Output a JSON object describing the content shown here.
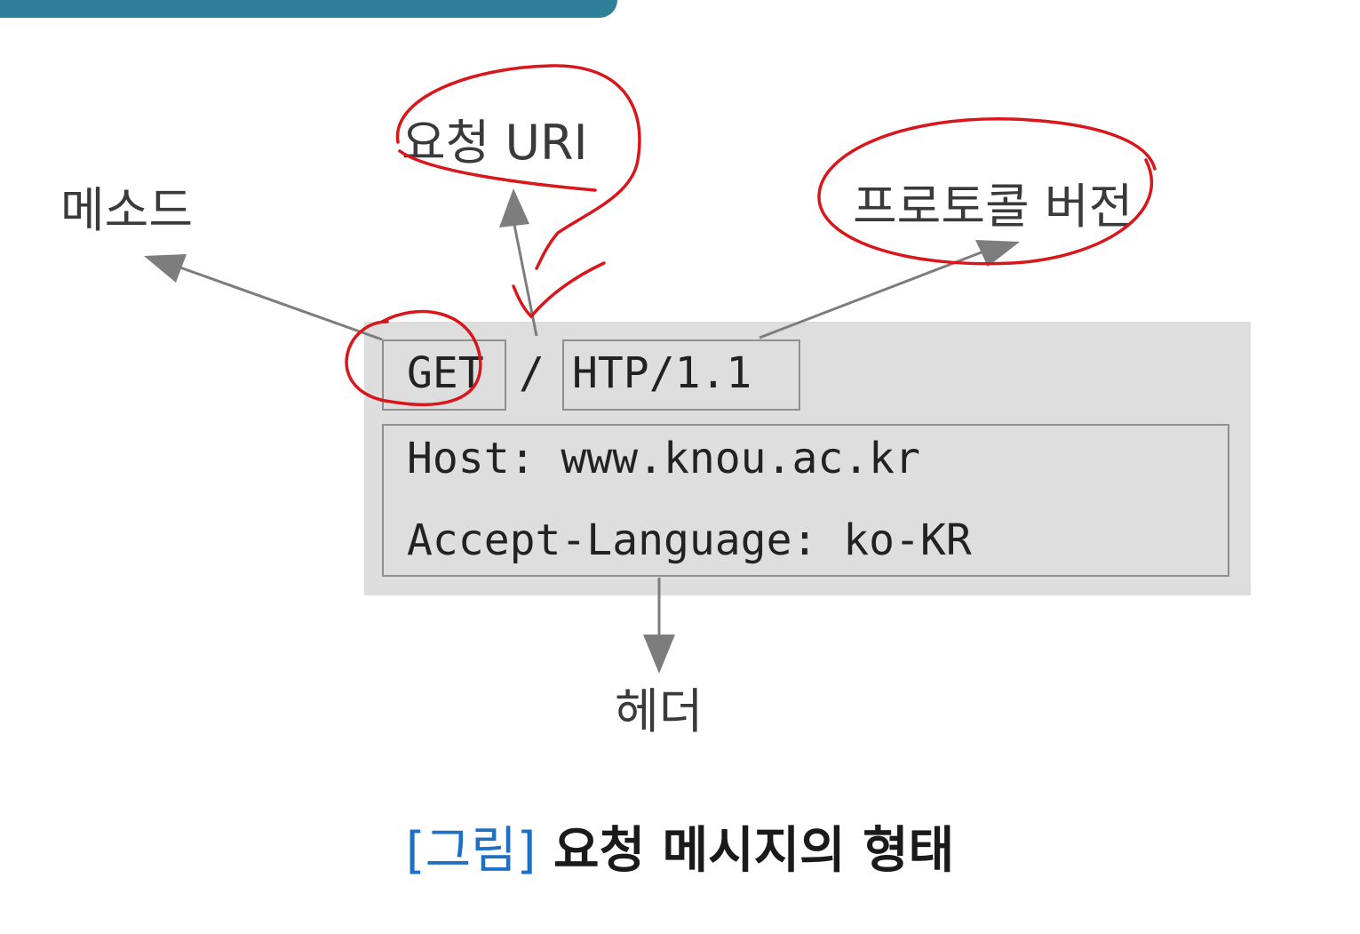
{
  "labels": {
    "method": "메소드",
    "request_uri": "요청 URI",
    "protocol_version": "프로토콜 버전",
    "header": "헤더"
  },
  "request_line": {
    "method": "GET",
    "uri": "/",
    "version": "HTP/1.1"
  },
  "headers": [
    "Host: www.knou.ac.kr",
    "Accept-Language: ko-KR"
  ],
  "caption": {
    "tag": "[그림]",
    "text": "요청 메시지의 형태"
  },
  "colors": {
    "accent_bar": "#2e7f9a",
    "panel": "#dededf",
    "arrow": "#7d7d7d",
    "annotation": "#d8161c",
    "caption_tag": "#1f6fc5"
  }
}
